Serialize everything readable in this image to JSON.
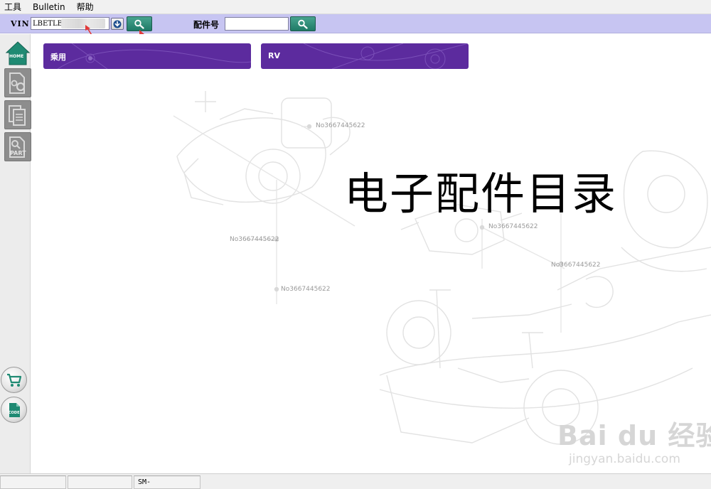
{
  "menu": {
    "items": [
      {
        "label": "工具"
      },
      {
        "label": "Bulletin"
      },
      {
        "label": "帮助"
      }
    ]
  },
  "search": {
    "vin_label": "VIN",
    "vin_value": "LBETLB",
    "part_label": "配件号",
    "part_value": ""
  },
  "sidebar": {
    "home_label": "HOME",
    "part_label": "PART",
    "code_label": "CODE"
  },
  "categories": [
    {
      "label": "乘用"
    },
    {
      "label": "RV"
    }
  ],
  "hero": {
    "title": "电子配件目录"
  },
  "part_numbers": [
    "No3667445622",
    "No3667445622",
    "No3667445622",
    "No3667445622",
    "No3667445622"
  ],
  "watermark": {
    "brand": "Bai du 经验",
    "url": "jingyan.baidu.com"
  },
  "status": {
    "cells": [
      "",
      "",
      "SM-"
    ]
  },
  "colors": {
    "toolbar": "#c7c5f2",
    "tile": "#5c2b9e",
    "search_button": "#2b8a74",
    "sidebar_button": "#8d8d8d"
  }
}
